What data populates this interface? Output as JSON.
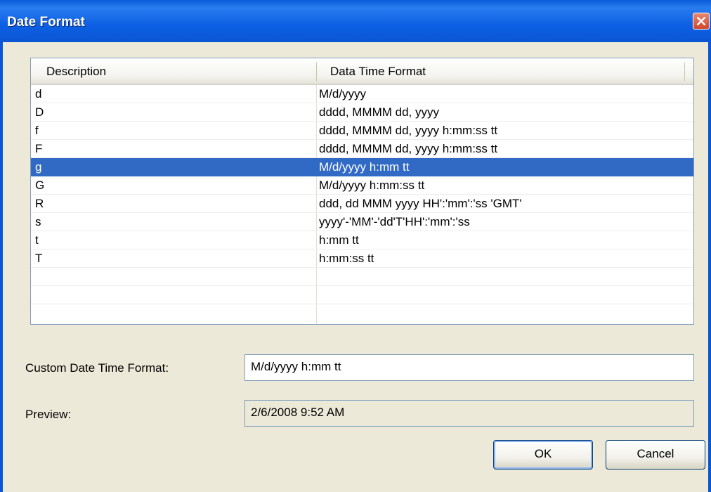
{
  "window": {
    "title": "Date Format"
  },
  "list": {
    "headers": [
      "Description",
      "Data Time Format"
    ],
    "rows": [
      {
        "desc": "d",
        "format": "M/d/yyyy",
        "selected": false
      },
      {
        "desc": "D",
        "format": "dddd, MMMM dd, yyyy",
        "selected": false
      },
      {
        "desc": "f",
        "format": "dddd, MMMM dd, yyyy h:mm:ss tt",
        "selected": false
      },
      {
        "desc": "F",
        "format": "dddd, MMMM dd, yyyy h:mm:ss tt",
        "selected": false
      },
      {
        "desc": "g",
        "format": "M/d/yyyy h:mm tt",
        "selected": true
      },
      {
        "desc": "G",
        "format": "M/d/yyyy h:mm:ss tt",
        "selected": false
      },
      {
        "desc": "R",
        "format": "ddd, dd MMM yyyy HH':'mm':'ss 'GMT'",
        "selected": false
      },
      {
        "desc": "s",
        "format": "yyyy'-'MM'-'dd'T'HH':'mm':'ss",
        "selected": false
      },
      {
        "desc": "t",
        "format": "h:mm tt",
        "selected": false
      },
      {
        "desc": "T",
        "format": "h:mm:ss tt",
        "selected": false
      },
      {
        "desc": "",
        "format": "",
        "selected": false
      },
      {
        "desc": "",
        "format": "",
        "selected": false
      }
    ]
  },
  "custom": {
    "label": "Custom Date Time  Format:",
    "value": "M/d/yyyy h:mm tt"
  },
  "preview": {
    "label": "Preview:",
    "value": "2/6/2008 9:52 AM"
  },
  "buttons": {
    "ok": "OK",
    "cancel": "Cancel"
  },
  "colors": {
    "title_bar": "#0b56d4",
    "selection": "#316ac5",
    "dialog_bg": "#ece9d8"
  }
}
